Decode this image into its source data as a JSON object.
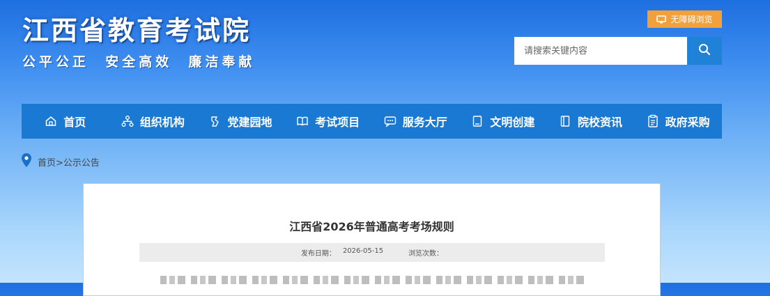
{
  "header": {
    "site_title": "江西省教育考试院",
    "slogan": "公平公正  安全高效  廉洁奉献",
    "barrier_free_label": "无障碍浏览",
    "search": {
      "placeholder": "请搜索关键内容",
      "value": "",
      "icon": "search-icon"
    }
  },
  "nav": {
    "items": [
      {
        "label": "首页",
        "icon": "home-icon"
      },
      {
        "label": "组织机构",
        "icon": "org-chart-icon"
      },
      {
        "label": "党建园地",
        "icon": "party-icon"
      },
      {
        "label": "考试项目",
        "icon": "book-icon"
      },
      {
        "label": "服务大厅",
        "icon": "chat-icon"
      },
      {
        "label": "文明创建",
        "icon": "notebook-icon"
      },
      {
        "label": "院校资讯",
        "icon": "document-icon"
      },
      {
        "label": "政府采购",
        "icon": "clipboard-icon"
      }
    ]
  },
  "breadcrumb": {
    "home": "首页",
    "separator": ">",
    "current": "公示公告",
    "icon": "location-pin-icon"
  },
  "article": {
    "title": "江西省2026年普通高考考场规则",
    "publish_label": "发布日期：",
    "publish_date": "2026-05-15",
    "views_label": "浏览次数："
  },
  "colors": {
    "nav_bg": "#1a79d3",
    "barrier_btn": "#f2a13a",
    "search_btn": "#1f82d6",
    "pin": "#1a6fc9"
  }
}
